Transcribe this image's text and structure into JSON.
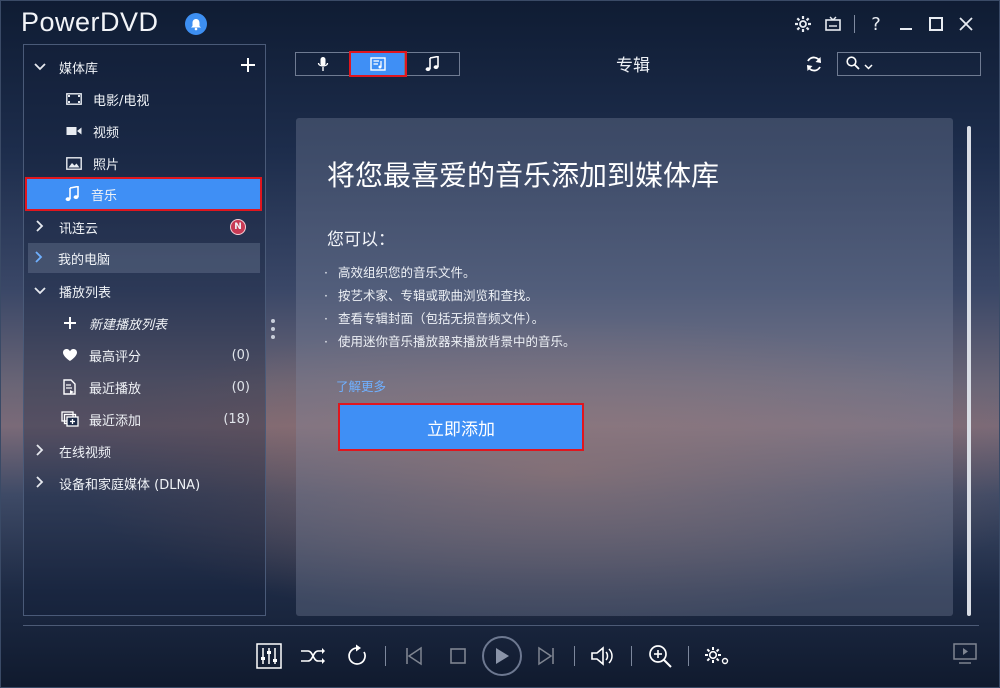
{
  "app": {
    "title": "PowerDVD"
  },
  "sidebar": {
    "items": [
      {
        "label": "媒体库"
      },
      {
        "label": "电影/电视"
      },
      {
        "label": "视频"
      },
      {
        "label": "照片"
      },
      {
        "label": "音乐"
      },
      {
        "label": "讯连云",
        "badge": "N"
      },
      {
        "label": "我的电脑"
      },
      {
        "label": "播放列表"
      },
      {
        "label": "新建播放列表"
      },
      {
        "label": "最高评分",
        "count": "(0)"
      },
      {
        "label": "最近播放",
        "count": "(0)"
      },
      {
        "label": "最近添加",
        "count": "(18)"
      },
      {
        "label": "在线视频"
      },
      {
        "label": "设备和家庭媒体 (DLNA)"
      }
    ]
  },
  "toolbar": {
    "view_title": "专辑",
    "search_placeholder": ""
  },
  "content": {
    "headline": "将您最喜爱的音乐添加到媒体库",
    "subheading": "您可以：",
    "bullets": [
      "高效组织您的音乐文件。",
      "按艺术家、专辑或歌曲浏览和查找。",
      "查看专辑封面（包括无损音频文件）。",
      "使用迷你音乐播放器来播放背景中的音乐。"
    ],
    "learn_more": "了解更多",
    "add_button": "立即添加"
  },
  "colors": {
    "accent": "#3f8ff5",
    "highlight": "#e0161e",
    "badge": "#c73a55"
  }
}
